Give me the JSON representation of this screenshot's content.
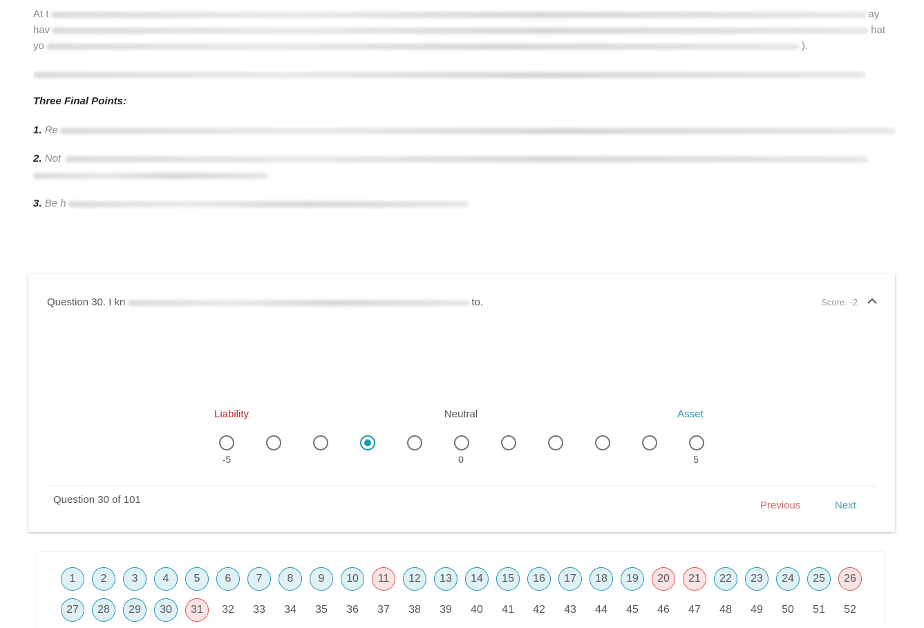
{
  "intro": {
    "line1_start": "At t",
    "line1_end": "ay",
    "line2_start": "hav",
    "line2_end": "hat",
    "line3_start": "yo",
    "line3_end": ")."
  },
  "section_title": "Three Final Points:",
  "points": [
    {
      "num": "1.",
      "text": "Re"
    },
    {
      "num": "2.",
      "text": "Not"
    },
    {
      "num": "3.",
      "text": "Be h"
    }
  ],
  "question": {
    "title_start": "Question 30.  I kn",
    "title_end": "to.",
    "score": "Score: -2",
    "collapse_icon": "chevron-up-icon",
    "labels": {
      "liability": "Liability",
      "neutral": "Neutral",
      "asset": "Asset"
    },
    "scale_values": [
      -5,
      -4,
      -3,
      -2,
      -1,
      0,
      1,
      2,
      3,
      4,
      5
    ],
    "selected": -2,
    "ticks": {
      "min": "-5",
      "mid": "0",
      "max": "5"
    },
    "progress": "Question 30 of 101",
    "prev_label": "Previous",
    "next_label": "Next"
  },
  "colors": {
    "accent": "#1e96b4",
    "liability": "#c62828",
    "flag": "#d9534f"
  },
  "navigator": {
    "answered": [
      1,
      2,
      3,
      4,
      5,
      6,
      7,
      8,
      9,
      10,
      12,
      13,
      14,
      15,
      16,
      17,
      18,
      19,
      22,
      23,
      24,
      25,
      27,
      28,
      29,
      30
    ],
    "flagged": [
      11,
      20,
      21,
      26,
      31
    ],
    "rows": [
      [
        "1",
        "2",
        "3",
        "4",
        "5",
        "6",
        "7",
        "8",
        "9",
        "10",
        "11",
        "12",
        "13",
        "14",
        "15",
        "16",
        "17",
        "18",
        "19",
        "20",
        "21",
        "22",
        "23",
        "24",
        "25",
        "26"
      ],
      [
        "27",
        "28",
        "29",
        "30",
        "31",
        "32",
        "33",
        "34",
        "35",
        "36",
        "37",
        "38",
        "39",
        "40",
        "41",
        "42",
        "43",
        "44",
        "45",
        "46",
        "47",
        "48",
        "49",
        "50",
        "51",
        "52"
      ]
    ]
  }
}
